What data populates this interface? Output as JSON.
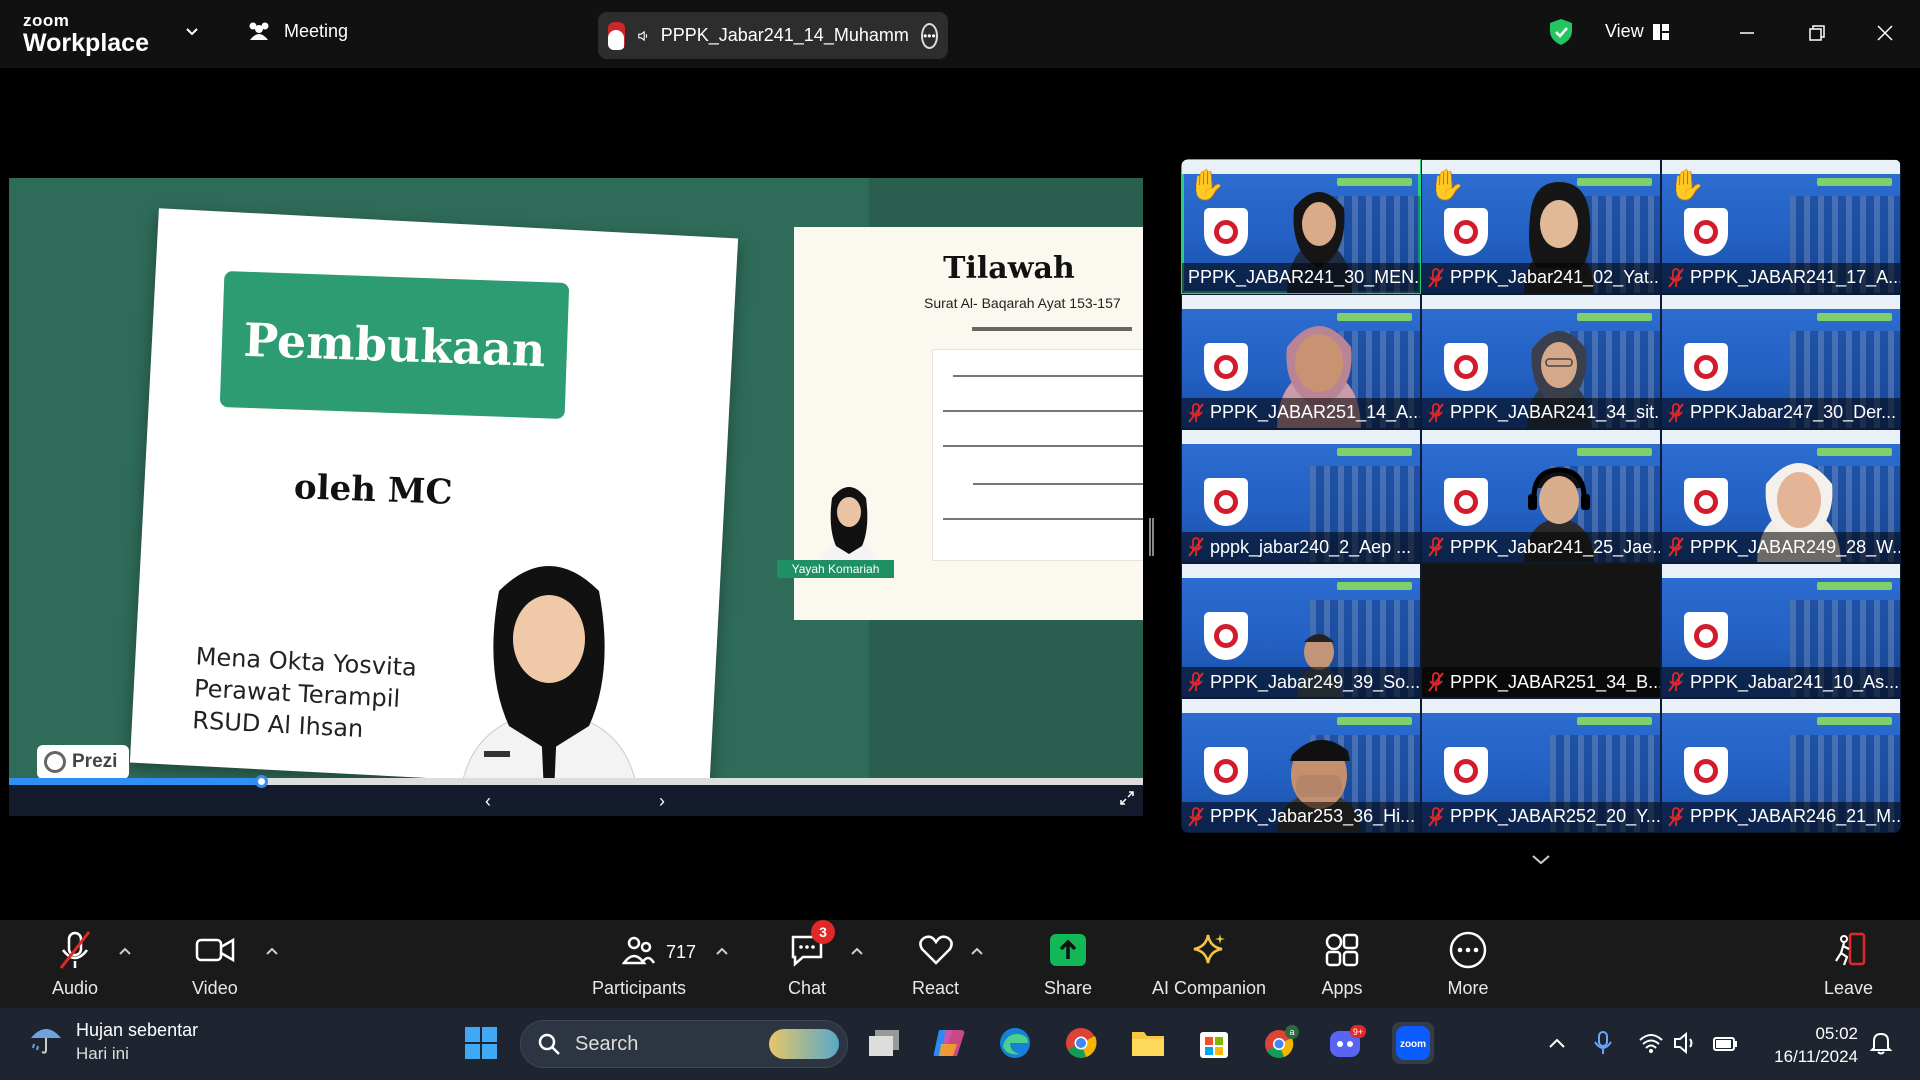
{
  "app": {
    "brand_top": "zoom",
    "brand_bottom": "Workplace",
    "meeting_label": "Meeting",
    "active_speaker": "PPPK_Jabar241_14_Muhamm",
    "view_label": "View"
  },
  "shared_screen": {
    "slide_title": "Pembukaan",
    "slide_subtitle": "oleh MC",
    "mc_name": "Mena Okta Yosvita",
    "mc_role": "Perawat Terampil",
    "mc_institution": "RSUD Al Ihsan",
    "prezi_label": "Prezi",
    "next_title": "Tilawah",
    "next_subtitle": "Surat Al- Baqarah Ayat 153-157",
    "presenter_tag": "Yayah Komariah",
    "progress_fraction": 0.222,
    "prev_arrow": "‹",
    "next_arrow": "›"
  },
  "gallery": {
    "tiles": [
      {
        "name": "PPPK_JABAR241_30_MEN...",
        "hand": true,
        "muted": false,
        "active": true,
        "face": "hijab-black"
      },
      {
        "name": "PPPK_Jabar241_02_Yat...",
        "hand": true,
        "muted": true,
        "active": false,
        "face": "hair-black"
      },
      {
        "name": "PPPK_JABAR241_17_A...",
        "hand": true,
        "muted": true,
        "active": false,
        "face": "none"
      },
      {
        "name": "PPPK_JABAR251_14_A...",
        "hand": false,
        "muted": true,
        "active": false,
        "face": "hijab-pink"
      },
      {
        "name": "PPPK_JABAR241_34_sit...",
        "hand": false,
        "muted": true,
        "active": false,
        "face": "hijab-dark"
      },
      {
        "name": "PPPKJabar247_30_Der...",
        "hand": false,
        "muted": true,
        "active": false,
        "face": "none"
      },
      {
        "name": "pppk_jabar240_2_Aep ...",
        "hand": false,
        "muted": true,
        "active": false,
        "face": "none"
      },
      {
        "name": "PPPK_Jabar241_25_Jae...",
        "hand": false,
        "muted": true,
        "active": false,
        "face": "headset"
      },
      {
        "name": "PPPK_JABAR249_28_W...",
        "hand": false,
        "muted": true,
        "active": false,
        "face": "hijab-white"
      },
      {
        "name": "PPPK_Jabar249_39_So...",
        "hand": false,
        "muted": true,
        "active": false,
        "face": "man-small"
      },
      {
        "name": "PPPK_JABAR251_34_B...",
        "hand": false,
        "muted": true,
        "active": false,
        "face": "dark"
      },
      {
        "name": "PPPK_Jabar241_10_As...",
        "hand": false,
        "muted": true,
        "active": false,
        "face": "none"
      },
      {
        "name": "PPPK_Jabar253_36_Hi...",
        "hand": false,
        "muted": true,
        "active": false,
        "face": "man-cap"
      },
      {
        "name": "PPPK_JABAR252_20_Y...",
        "hand": false,
        "muted": true,
        "active": false,
        "face": "none"
      },
      {
        "name": "PPPK_JABAR246_21_M...",
        "hand": false,
        "muted": true,
        "active": false,
        "face": "none"
      }
    ]
  },
  "toolbar": {
    "audio": "Audio",
    "video": "Video",
    "participants": "Participants",
    "participants_count": "717",
    "chat": "Chat",
    "chat_badge": "3",
    "react": "React",
    "share": "Share",
    "ai_companion": "AI Companion",
    "apps": "Apps",
    "more": "More",
    "leave": "Leave"
  },
  "taskbar": {
    "weather_title": "Hujan sebentar",
    "weather_sub": "Hari ini",
    "search_label": "Search",
    "time": "05:02",
    "date": "16/11/2024",
    "chrome_badge": "a",
    "discord_badge": "9+"
  },
  "colors": {
    "accent_green": "#27d07a",
    "share_green": "#2e9c72",
    "mute_red": "#e02828",
    "zoom_blue": "#0b5cff"
  }
}
